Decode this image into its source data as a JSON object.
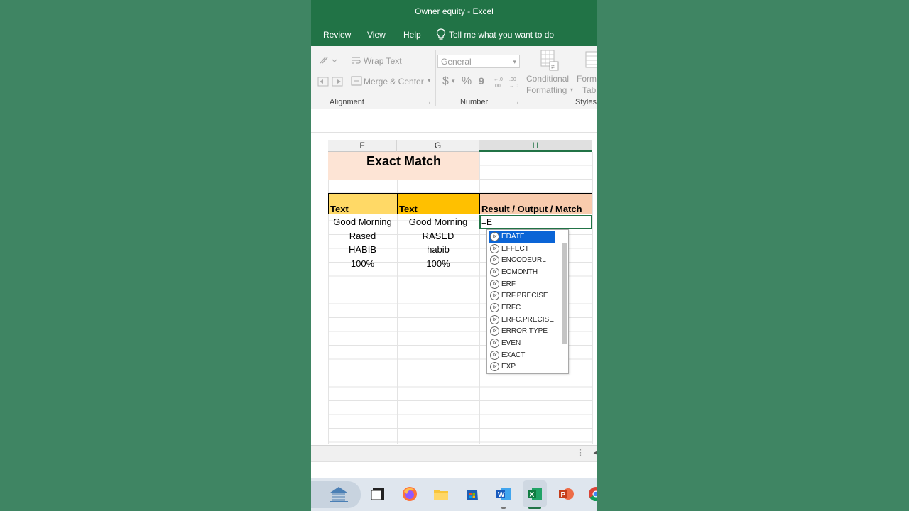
{
  "window": {
    "title": "Owner equity  -  Excel"
  },
  "menu": {
    "items": [
      "Review",
      "View",
      "Help"
    ],
    "tell_me": "Tell me what you want to do"
  },
  "ribbon": {
    "wrap_text": "Wrap Text",
    "merge_center": "Merge & Center",
    "number_format": "General",
    "currency": "$",
    "percent": "%",
    "comma": "9",
    "conditional": "Conditional",
    "formatting": "Formatting",
    "format_as": "Forma",
    "table": "Table",
    "groups": {
      "alignment": "Alignment",
      "number": "Number",
      "styles": "Styles"
    }
  },
  "columns": [
    "F",
    "G",
    "H"
  ],
  "sheet": {
    "title": "Exact Match",
    "headers": [
      "Text",
      "Text",
      "Result / Output / Match"
    ],
    "rows": [
      [
        "Good Morning",
        "Good Morning"
      ],
      [
        "Rased",
        "RASED"
      ],
      [
        "HABIB",
        "habib"
      ],
      [
        "100%",
        "100%"
      ]
    ],
    "active_input": "=E"
  },
  "autocomplete": [
    "EDATE",
    "EFFECT",
    "ENCODEURL",
    "EOMONTH",
    "ERF",
    "ERF.PRECISE",
    "ERFC",
    "ERFC.PRECISE",
    "ERROR.TYPE",
    "EVEN",
    "EXACT",
    "EXP"
  ],
  "colors": {
    "excel_green": "#217346",
    "title_fill": "#fde4d5",
    "header_f": "#ffd966",
    "header_g": "#ffc000",
    "header_h": "#f8cbad",
    "selection_blue": "#0a64d6",
    "background": "#3f8563"
  }
}
